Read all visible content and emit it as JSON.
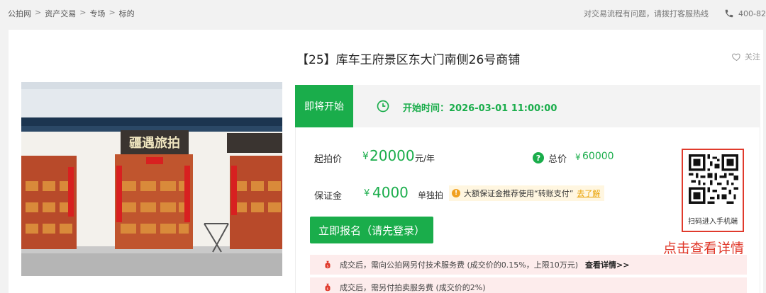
{
  "breadcrumb": [
    "公拍网",
    "资产交易",
    "专场",
    "标的"
  ],
  "breadcrumb_sep": ">",
  "help": {
    "text": "对交易流程有问题，请拨打客服热线",
    "phone": "400-82"
  },
  "lot": {
    "title": "【25】库车王府景区东大门南侧26号商铺",
    "follow_label": "关注"
  },
  "status": {
    "badge": "即将开始",
    "start_label": "开始时间：",
    "start_time": "2026-03-01 11:00:00"
  },
  "price": {
    "start_label": "起拍价",
    "currency": "¥",
    "start_value": "20000",
    "start_unit": "元/年",
    "total_label": "总价",
    "total_value": "60000",
    "deposit_label": "保证金",
    "deposit_value": "4000",
    "bid_mode": "单独拍",
    "tip_text": "大额保证金推荐使用“转账支付”",
    "tip_link": "去了解"
  },
  "signup_button": "立即报名（请先登录）",
  "fees": [
    {
      "text": "成交后，需向公拍网另付技术服务费 (成交价的0.15%，上限10万元)",
      "link": "查看详情>>"
    },
    {
      "text": "成交后，需另付拍卖服务费 (成交价的2%)",
      "link": ""
    }
  ],
  "qr": {
    "label": "扫码进入手机端",
    "hint": "点击查看详情"
  },
  "photo": {
    "shop_sign": "疆遇旅拍"
  },
  "colors": {
    "brand_green": "#1aad4b",
    "alert_red": "#e03a2c",
    "fee_bg": "#fdecec",
    "tip_orange": "#f0a020"
  },
  "icons": [
    "phone-icon",
    "heart-icon",
    "clock-icon",
    "question-icon",
    "info-icon",
    "money-bag-icon",
    "qr-code",
    "chevron-left-icon"
  ]
}
